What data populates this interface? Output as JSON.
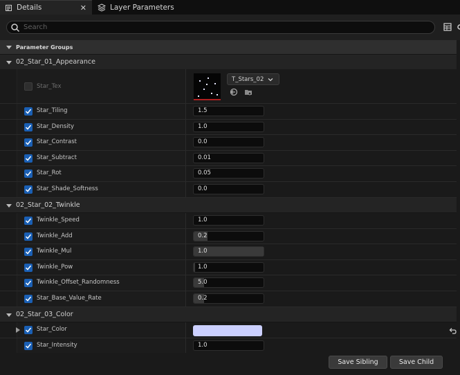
{
  "tabs": [
    {
      "label": "Details",
      "close": "✕"
    },
    {
      "label": "Layer Parameters"
    }
  ],
  "search": {
    "placeholder": "Search"
  },
  "parameter_groups_label": "Parameter Groups",
  "sections": [
    {
      "label": "02_Star_01_Appearance"
    },
    {
      "label": "02_Star_02_Twinkle"
    },
    {
      "label": "02_Star_03_Color"
    }
  ],
  "texture": {
    "name": "Star_Tex",
    "asset": "T_Stars_02"
  },
  "params": [
    {
      "name": "Star_Tiling",
      "value": "1.5"
    },
    {
      "name": "Star_Density",
      "value": "1.0"
    },
    {
      "name": "Star_Contrast",
      "value": "0.0"
    },
    {
      "name": "Star_Subtract",
      "value": "0.01"
    },
    {
      "name": "Star_Rot",
      "value": "0.05"
    },
    {
      "name": "Star_Shade_Softness",
      "value": "0.0"
    },
    {
      "name": "Twinkle_Speed",
      "value": "1.0"
    },
    {
      "name": "Twinkle_Add",
      "value": "0.2",
      "fill": 0.2
    },
    {
      "name": "Twinkle_Mul",
      "value": "1.0",
      "fill": 1.0
    },
    {
      "name": "Twinkle_Pow",
      "value": "1.0",
      "fill": 0.02
    },
    {
      "name": "Twinkle_Offset_Randomness",
      "value": "5.0",
      "fill": 0.15
    },
    {
      "name": "Star_Base_Value_Rate",
      "value": "0.2",
      "fill": 0.15
    },
    {
      "name": "Star_Color",
      "color": "#ccd0ff"
    },
    {
      "name": "Star_Intensity",
      "value": "1.0"
    }
  ],
  "buttons": {
    "save_sibling": "Save Sibling",
    "save_child": "Save Child"
  },
  "colors": {
    "accent": "#1a5fb4",
    "star_color": "#ccd0ff"
  }
}
